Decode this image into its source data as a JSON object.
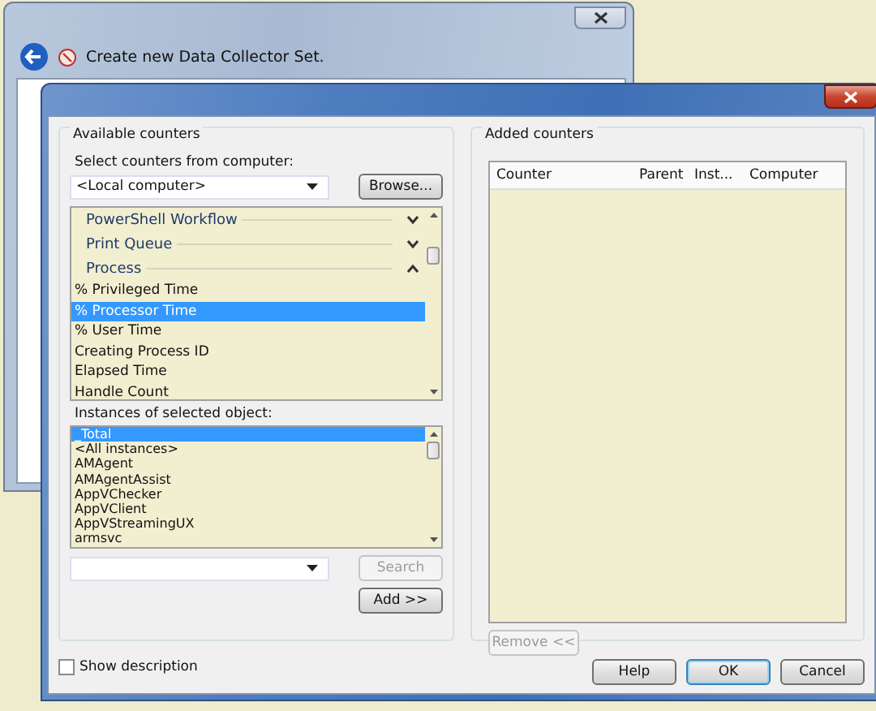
{
  "background_window": {
    "title": "Create new Data Collector Set."
  },
  "available_counters": {
    "legend": "Available counters",
    "computer_label": "Select counters from computer:",
    "computer": "<Local computer>",
    "browse_button": "Browse...",
    "counters": [
      {
        "kind": "group",
        "label": "PowerShell Workflow",
        "expanded": false
      },
      {
        "kind": "group",
        "label": "Print Queue",
        "expanded": false
      },
      {
        "kind": "group",
        "label": "Process",
        "expanded": true
      },
      {
        "kind": "item",
        "label": "% Privileged Time",
        "selected": false
      },
      {
        "kind": "item",
        "label": "% Processor Time",
        "selected": true
      },
      {
        "kind": "item",
        "label": "% User Time",
        "selected": false
      },
      {
        "kind": "item",
        "label": "Creating Process ID",
        "selected": false
      },
      {
        "kind": "item",
        "label": "Elapsed Time",
        "selected": false
      },
      {
        "kind": "item",
        "label": "Handle Count",
        "selected": false
      }
    ],
    "instances_label": "Instances of selected object:",
    "instances": [
      {
        "label": "_Total",
        "selected": true
      },
      {
        "label": "<All instances>",
        "selected": false
      },
      {
        "label": "AMAgent",
        "selected": false
      },
      {
        "label": "AMAgentAssist",
        "selected": false
      },
      {
        "label": "AppVChecker",
        "selected": false
      },
      {
        "label": "AppVClient",
        "selected": false
      },
      {
        "label": "AppVStreamingUX",
        "selected": false
      },
      {
        "label": "armsvc",
        "selected": false
      }
    ],
    "search_button": {
      "label": "Search",
      "disabled": true
    },
    "add_button": "Add >>"
  },
  "added_counters": {
    "legend": "Added counters",
    "columns": [
      "Counter",
      "Parent",
      "Inst...",
      "Computer"
    ],
    "remove_button": {
      "label": "Remove <<",
      "disabled": true
    }
  },
  "show_description": {
    "label": "Show description",
    "checked": false
  },
  "buttons": [
    {
      "label": "Help",
      "default": false
    },
    {
      "label": "OK",
      "default": true
    },
    {
      "label": "Cancel",
      "default": false
    }
  ]
}
